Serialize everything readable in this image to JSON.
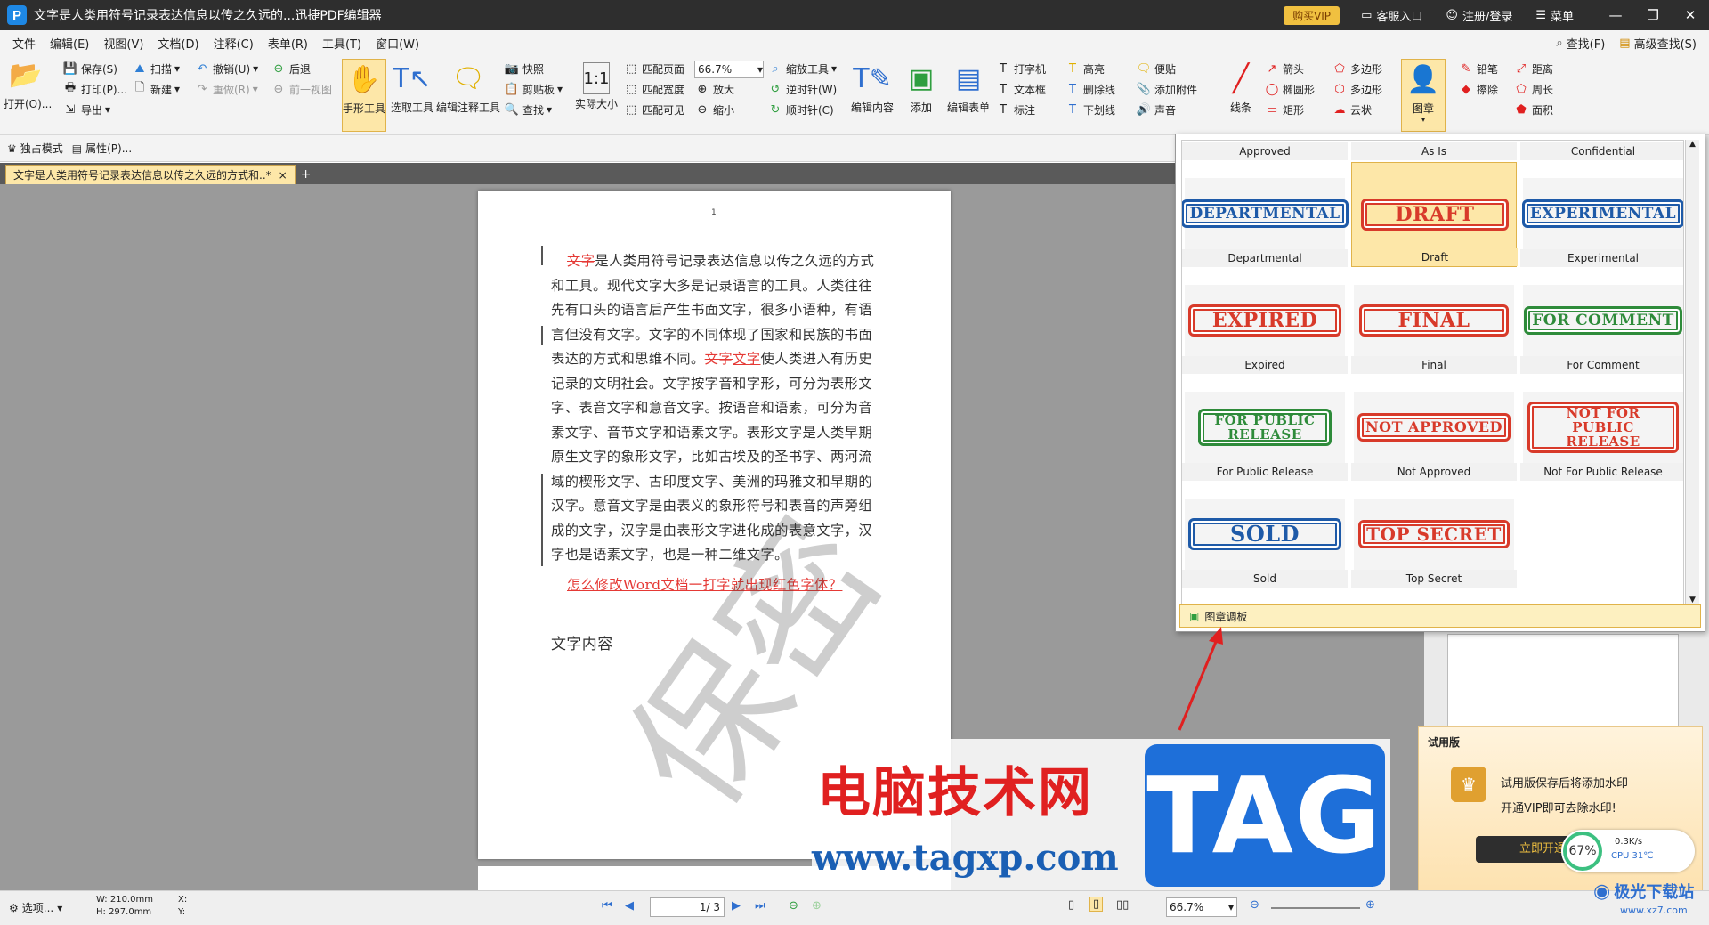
{
  "titlebar": {
    "title": "文字是人类用符号记录表达信息以传之久远的...迅捷PDF编辑器",
    "vip": "购买VIP",
    "service": "客服入口",
    "login": "注册/登录",
    "menu": "菜单"
  },
  "menubar": {
    "items": [
      "文件",
      "编辑(E)",
      "视图(V)",
      "文档(D)",
      "注释(C)",
      "表单(R)",
      "工具(T)",
      "窗口(W)"
    ],
    "find": "查找(F)",
    "advanced_find": "高级查找(S)"
  },
  "ribbon": {
    "open": "打开(O)...",
    "save": "保存(S)",
    "print": "打印(P)...",
    "export": "导出",
    "scan": "扫描",
    "new": "新建",
    "undo": "撤销(U)",
    "redo": "重做(R)",
    "back": "后退",
    "prev_view": "前一视图",
    "hand": "手形工具",
    "select": "选取工具",
    "edit_annot": "编辑注释工具",
    "snapshot": "快照",
    "clipboard": "剪贴板",
    "find": "查找",
    "actual_size": "实际大小",
    "fit_page": "匹配页面",
    "fit_width": "匹配宽度",
    "fit_visible": "匹配可见",
    "zoom_value": "66.7%",
    "zoom_tool": "缩放工具",
    "zoom_in": "放大",
    "zoom_out": "缩小",
    "rot_ccw": "逆时针(W)",
    "rot_cw": "顺时针(C)",
    "edit_content": "编辑内容",
    "add": "添加",
    "edit_form": "编辑表单",
    "typewriter": "打字机",
    "textbox": "文本框",
    "callout": "标注",
    "highlight": "高亮",
    "strikeout": "删除线",
    "underline": "下划线",
    "note": "便贴",
    "attach": "添加附件",
    "sound": "声音",
    "line": "线条",
    "arrow": "箭头",
    "ellipse": "椭圆形",
    "rect": "矩形",
    "polygon": "多边形",
    "polyline": "多边形",
    "cloud": "云状",
    "stamp": "图章",
    "pencil": "铅笔",
    "eraser": "擦除",
    "distance": "距离",
    "perimeter": "周长",
    "area": "面积"
  },
  "toolbar2": {
    "exclusive": "独占模式",
    "properties": "属性(P)..."
  },
  "tab": {
    "label": "文字是人类用符号记录表达信息以传之久远的方式和..*",
    "close": "×",
    "add": "+"
  },
  "document": {
    "page_number": "1",
    "para1_strike": "文字",
    "para1_a": "是人类用符号记录表达信息以传之久远的方式和工具。现代文字大多是记录语言的工具。人类往往先有口头的语言后产生书面文字，很多小语种，有语言但没有文字。文字的不同体现了国家和民族的书面表达的方式和思维不同。",
    "para1_strike2": "文字",
    "para1_ul": "文字",
    "para1_b": "使人类进入有历史记录的文明社会。文字按字音和字形，可分为表形文字、表音文字和意音文字。按语音和语素，可分为音素文字、音节文字和语素文字。表形文字是人类早期原生文字的象形文字，比如古埃及的圣书字、两河流域的楔形文字、古印度文字、美洲的玛雅文和早期的汉字。意音文字是由表义的象形符号和表音的声旁组成的文字，汉字是由表形文字进化成的表意文字，汉字也是语素文字，也是一种二维文字。",
    "link": "怎么修改Word文档一打字就出现红色字体？",
    "heading": "文字内容",
    "watermark": "保密"
  },
  "stamp_panel": {
    "top_labels": [
      "Approved",
      "As Is",
      "Confidential"
    ],
    "stamps": [
      {
        "text": "DEPARTMENTAL",
        "label": "Departmental",
        "color": "blue"
      },
      {
        "text": "DRAFT",
        "label": "Draft",
        "color": "red"
      },
      {
        "text": "EXPERIMENTAL",
        "label": "Experimental",
        "color": "blue"
      },
      {
        "text": "EXPIRED",
        "label": "Expired",
        "color": "red"
      },
      {
        "text": "FINAL",
        "label": "Final",
        "color": "red"
      },
      {
        "text": "FOR COMMENT",
        "label": "For Comment",
        "color": "green"
      },
      {
        "text": "FOR PUBLIC RELEASE",
        "label": "For Public Release",
        "color": "green"
      },
      {
        "text": "NOT APPROVED",
        "label": "Not Approved",
        "color": "red"
      },
      {
        "text": "NOT FOR PUBLIC RELEASE",
        "label": "Not For Public Release",
        "color": "red"
      },
      {
        "text": "SOLD",
        "label": "Sold",
        "color": "blue"
      },
      {
        "text": "TOP SECRET",
        "label": "Top Secret",
        "color": "red"
      }
    ],
    "selected": "Draft",
    "footer": "图章调板"
  },
  "trial": {
    "title": "试用版",
    "line1": "试用版保存后将添加水印",
    "line2": "开通VIP即可去除水印!",
    "button": "立即开通",
    "gauge": "67%",
    "speed": "0.3K/s",
    "cpu": "CPU 31℃"
  },
  "statusbar": {
    "options": "选项...",
    "w": "W: 210.0mm",
    "h": "H: 297.0mm",
    "x": "X:",
    "y": "Y:",
    "page_value": "1",
    "page_total": "/ 3",
    "zoom": "66.7%"
  },
  "overlay": {
    "brand": "电脑技术网",
    "url": "www.tagxp.com",
    "tag": "TAG",
    "site2": "极光下载站",
    "site2_url": "www.xz7.com"
  },
  "colors": {
    "accent": "#fde7a8",
    "annot_red": "#e53935",
    "stamp_blue": "#1e5aa8",
    "stamp_red": "#d83a2a",
    "stamp_green": "#2e8b3a"
  }
}
